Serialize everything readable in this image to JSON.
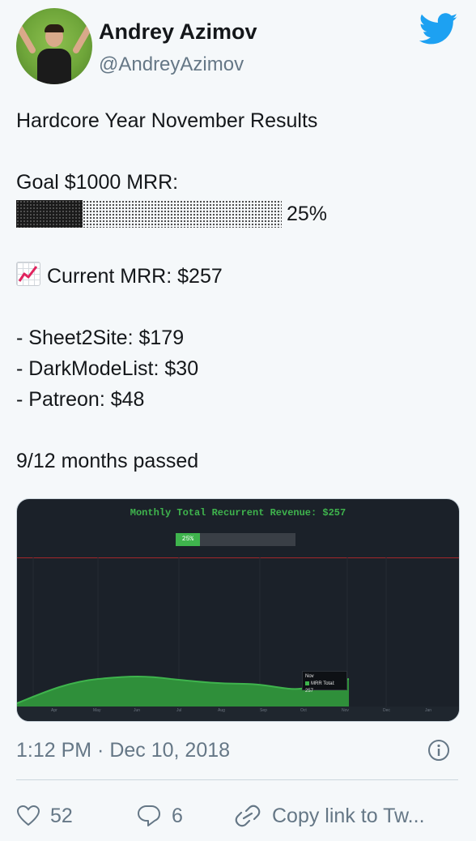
{
  "user": {
    "name": "Andrey Azimov",
    "handle": "@AndreyAzimov"
  },
  "tweet": {
    "title": "Hardcore Year November Results",
    "goal_label": "Goal $1000 MRR:",
    "goal_progress": 0.25,
    "goal_percent": "25%",
    "current_mrr": "Current MRR: $257",
    "items": [
      "- Sheet2Site: $179",
      "- DarkModeList: $30",
      "- Patreon: $48"
    ],
    "months_passed": "9/12 months passed"
  },
  "media": {
    "title": "Monthly Total Recurrent Revenue: $257",
    "progress_label": "25%",
    "tooltip_month": "Nov",
    "tooltip_value": "MRR Total: 257",
    "months": [
      "Apr",
      "May",
      "Jun",
      "Jul",
      "Aug",
      "Sep",
      "Oct",
      "Nov",
      "Dec",
      "Jan"
    ]
  },
  "meta": {
    "timestamp": "1:12 PM · Dec 10, 2018"
  },
  "actions": {
    "likes": "52",
    "replies": "6",
    "copy_link": "Copy link to Tw..."
  },
  "colors": {
    "twitter_blue": "#1da1f2",
    "text_primary": "#14171a",
    "text_secondary": "#657786",
    "chart_green": "#3fb44d",
    "chart_bg": "#1b2129",
    "goal_red": "#a3272b"
  },
  "icons": {
    "bird": "twitter-bird-icon",
    "chart_emoji": "chart-increasing-icon",
    "info": "info-icon",
    "like": "heart-icon",
    "reply": "reply-icon",
    "link": "link-icon"
  }
}
